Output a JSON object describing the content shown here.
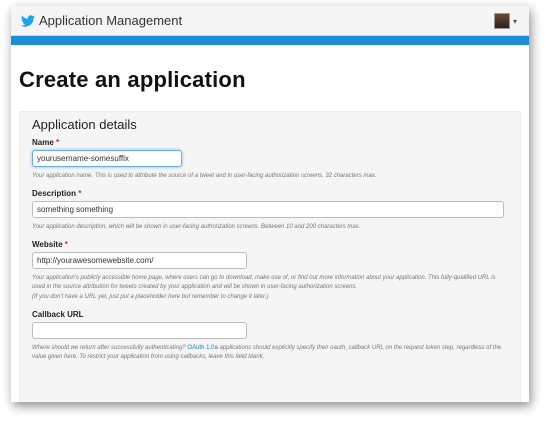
{
  "header": {
    "app_title": "Application Management",
    "user_caret": "▾"
  },
  "page": {
    "title": "Create an application"
  },
  "panel": {
    "title": "Application details"
  },
  "fields": {
    "name": {
      "label": "Name",
      "required_mark": "*",
      "value": "yourusername-somesuffix",
      "help": "Your application name. This is used to attribute the source of a tweet and in user-facing authorization screens. 32 characters max."
    },
    "description": {
      "label": "Description",
      "required_mark": "*",
      "value": "something something",
      "help": "Your application description, which will be shown in user-facing authorization screens. Between 10 and 200 characters max."
    },
    "website": {
      "label": "Website",
      "required_mark": "*",
      "value": "http://yourawesomewebsite.com/",
      "help_1": "Your application's publicly accessible home page, where users can go to download, make use of, or find out more information about your application. This fully-qualified URL is used in the source attribution for tweets created by your application and will be shown in user-facing authorization screens.",
      "help_2": "(If you don't have a URL yet, just put a placeholder here but remember to change it later.)"
    },
    "callback": {
      "label": "Callback URL",
      "value": "",
      "help_before": "Where should we return after successfully authenticating?",
      "help_link": "OAuth 1.0a",
      "help_after": "applications should explicitly specify their oauth_callback URL on the request token step, regardless of the value given here. To restrict your application from using callbacks, leave this field blank."
    }
  },
  "colors": {
    "accent_bar": "#1a8fd6",
    "required": "#d6272a",
    "link": "#1a7bc7"
  }
}
